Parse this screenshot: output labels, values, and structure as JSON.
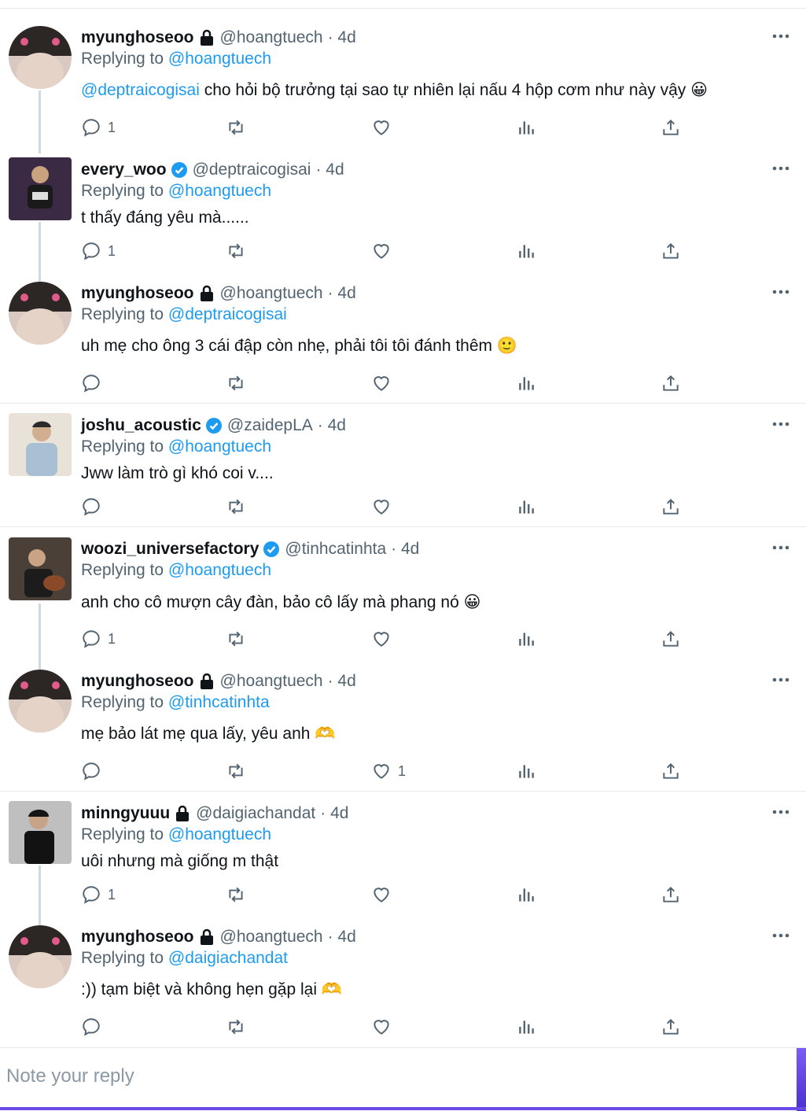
{
  "tweets": [
    {
      "name": "myunghoseoo",
      "badge": "lock",
      "handle": "@hoangtuech",
      "time": "· 4d",
      "replying_prefix": "Replying to",
      "replying_to": "@hoangtuech",
      "mention": "@deptraicogisai",
      "text": " cho hỏi bộ trưởng tại sao tự nhiên lại nấu 4 hộp cơm như này vậy 😀",
      "replies": "1",
      "likes": ""
    },
    {
      "name": "every_woo",
      "badge": "verified",
      "handle": "@deptraicogisai",
      "time": "· 4d",
      "replying_prefix": "Replying to",
      "replying_to": "@hoangtuech",
      "mention": "",
      "text": "t thấy đáng yêu mà......",
      "replies": "1",
      "likes": ""
    },
    {
      "name": "myunghoseoo",
      "badge": "lock",
      "handle": "@hoangtuech",
      "time": "· 4d",
      "replying_prefix": "Replying to",
      "replying_to": "@deptraicogisai",
      "mention": "",
      "text": "uh mẹ cho ông 3 cái đập còn nhẹ, phải tôi tôi đánh thêm 🙂",
      "replies": "",
      "likes": ""
    },
    {
      "name": "joshu_acoustic",
      "badge": "verified",
      "handle": "@zaidepLA",
      "time": "· 4d",
      "replying_prefix": "Replying to",
      "replying_to": "@hoangtuech",
      "mention": "",
      "text": "Jww làm trò gì khó coi v....",
      "replies": "",
      "likes": ""
    },
    {
      "name": "woozi_universefactory",
      "badge": "verified",
      "handle": "@tinhcatinhta",
      "time": "· 4d",
      "replying_prefix": "Replying to",
      "replying_to": "@hoangtuech",
      "mention": "",
      "text": " anh cho cô mượn cây đàn, bảo cô lấy mà phang nó 😀",
      "replies": "1",
      "likes": ""
    },
    {
      "name": "myunghoseoo",
      "badge": "lock",
      "handle": "@hoangtuech",
      "time": "· 4d",
      "replying_prefix": "Replying to",
      "replying_to": "@tinhcatinhta",
      "mention": "",
      "text": "mẹ bảo lát mẹ qua lấy, yêu anh 🫶",
      "replies": "",
      "likes": "1"
    },
    {
      "name": "minngyuuu",
      "badge": "lock",
      "handle": "@daigiachandat",
      "time": "· 4d",
      "replying_prefix": "Replying to",
      "replying_to": "@hoangtuech",
      "mention": "",
      "text": "uôi nhưng mà giống m thật",
      "replies": "1",
      "likes": ""
    },
    {
      "name": "myunghoseoo",
      "badge": "lock",
      "handle": "@hoangtuech",
      "time": "· 4d",
      "replying_prefix": "Replying to",
      "replying_to": "@daigiachandat",
      "mention": "",
      "text": " :)) tạm biệt và không hẹn gặp lại 🫶",
      "replies": "",
      "likes": ""
    }
  ],
  "reply_box": {
    "placeholder": "Note your reply"
  },
  "colors": {
    "link": "#1d9bf0",
    "muted": "#536471",
    "verified": "#1d9bf0",
    "thread_line": "#cfd9de"
  },
  "icons": {
    "reply": "reply-icon",
    "retweet": "retweet-icon",
    "like": "heart-icon",
    "views": "views-icon",
    "share": "share-icon",
    "more": "more-icon",
    "lock": "lock-icon",
    "verified": "verified-badge-icon"
  }
}
